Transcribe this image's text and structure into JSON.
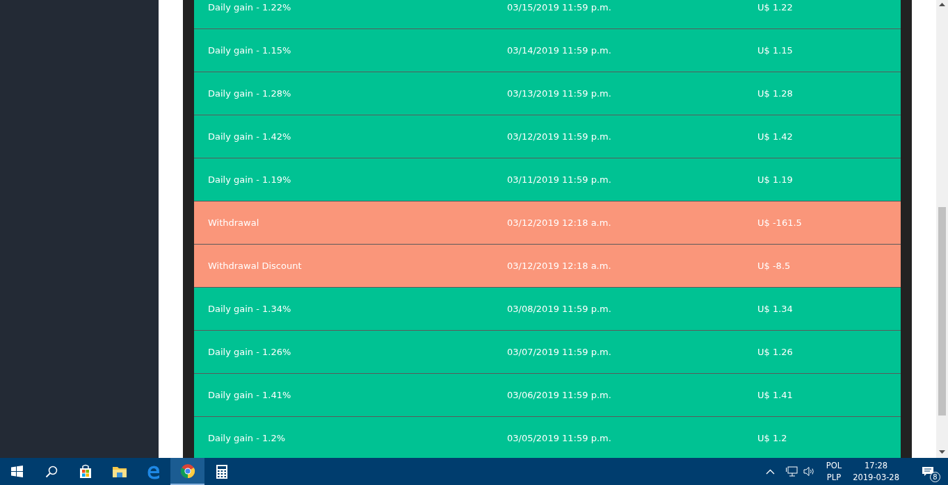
{
  "transactions": [
    {
      "kind": "gain",
      "description": "Daily gain - 1.22%",
      "date": "03/15/2019 11:59 p.m.",
      "amount": "U$ 1.22"
    },
    {
      "kind": "gain",
      "description": "Daily gain - 1.15%",
      "date": "03/14/2019 11:59 p.m.",
      "amount": "U$ 1.15"
    },
    {
      "kind": "gain",
      "description": "Daily gain - 1.28%",
      "date": "03/13/2019 11:59 p.m.",
      "amount": "U$ 1.28"
    },
    {
      "kind": "gain",
      "description": "Daily gain - 1.42%",
      "date": "03/12/2019 11:59 p.m.",
      "amount": "U$ 1.42"
    },
    {
      "kind": "gain",
      "description": "Daily gain - 1.19%",
      "date": "03/11/2019 11:59 p.m.",
      "amount": "U$ 1.19"
    },
    {
      "kind": "withdrawal",
      "description": "Withdrawal",
      "date": "03/12/2019 12:18 a.m.",
      "amount": "U$ -161.5"
    },
    {
      "kind": "withdrawal",
      "description": "Withdrawal Discount",
      "date": "03/12/2019 12:18 a.m.",
      "amount": "U$ -8.5"
    },
    {
      "kind": "gain",
      "description": "Daily gain - 1.34%",
      "date": "03/08/2019 11:59 p.m.",
      "amount": "U$ 1.34"
    },
    {
      "kind": "gain",
      "description": "Daily gain - 1.26%",
      "date": "03/07/2019 11:59 p.m.",
      "amount": "U$ 1.26"
    },
    {
      "kind": "gain",
      "description": "Daily gain - 1.41%",
      "date": "03/06/2019 11:59 p.m.",
      "amount": "U$ 1.41"
    },
    {
      "kind": "gain",
      "description": "Daily gain - 1.2%",
      "date": "03/05/2019 11:59 p.m.",
      "amount": "U$ 1.2"
    }
  ],
  "taskbar": {
    "apps": [
      {
        "kind": "store",
        "selected": false
      },
      {
        "kind": "explorer",
        "selected": false
      },
      {
        "kind": "edge",
        "selected": false
      },
      {
        "kind": "chrome",
        "selected": true
      },
      {
        "kind": "calculator",
        "selected": false
      }
    ],
    "language": "POL",
    "layout": "PLP",
    "time": "17:28",
    "date": "2019-03-28",
    "notifications": "8"
  }
}
